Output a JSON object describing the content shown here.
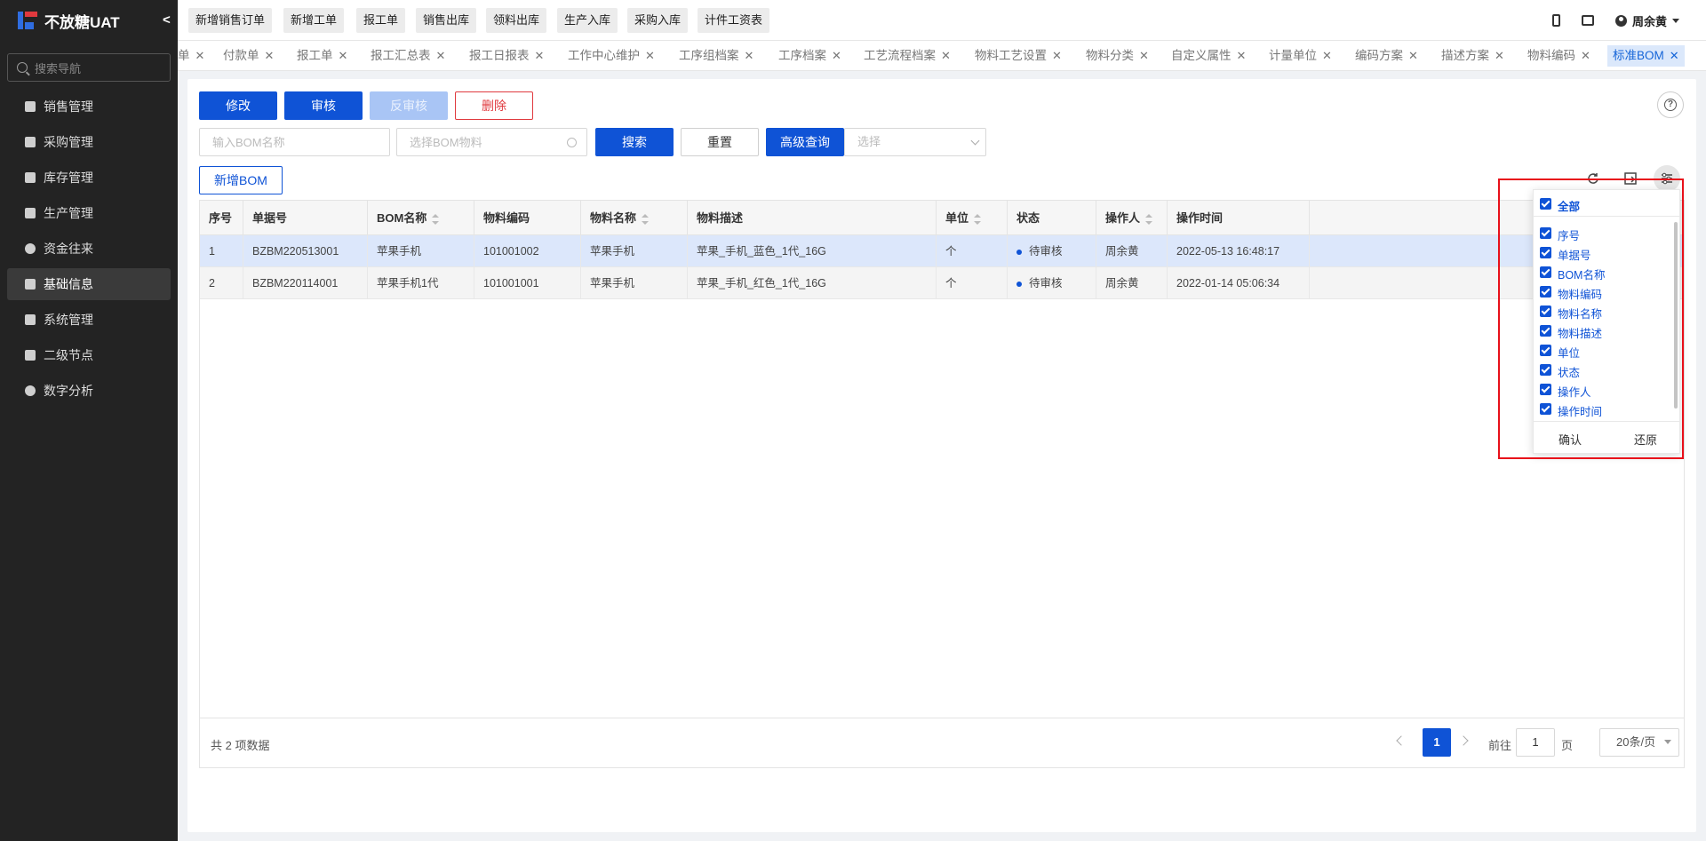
{
  "app": {
    "title": "不放糖UAT"
  },
  "sidebar": {
    "search_placeholder": "搜索导航",
    "items": [
      {
        "label": "销售管理"
      },
      {
        "label": "采购管理"
      },
      {
        "label": "库存管理"
      },
      {
        "label": "生产管理"
      },
      {
        "label": "资金往来"
      },
      {
        "label": "基础信息",
        "active": true
      },
      {
        "label": "系统管理"
      },
      {
        "label": "二级节点"
      },
      {
        "label": "数字分析"
      }
    ]
  },
  "topbar": {
    "quick": [
      "新增销售订单",
      "新增工单",
      "报工单",
      "销售出库",
      "领料出库",
      "生产入库",
      "采购入库",
      "计件工资表"
    ],
    "user": "周余黄"
  },
  "tabs": [
    {
      "label": "单"
    },
    {
      "label": "付款单"
    },
    {
      "label": "报工单"
    },
    {
      "label": "报工汇总表"
    },
    {
      "label": "报工日报表"
    },
    {
      "label": "工作中心维护"
    },
    {
      "label": "工序组档案"
    },
    {
      "label": "工序档案"
    },
    {
      "label": "工艺流程档案"
    },
    {
      "label": "物料工艺设置"
    },
    {
      "label": "物料分类"
    },
    {
      "label": "自定义属性"
    },
    {
      "label": "计量单位"
    },
    {
      "label": "编码方案"
    },
    {
      "label": "描述方案"
    },
    {
      "label": "物料编码"
    },
    {
      "label": "标准BOM",
      "active": true
    }
  ],
  "toolbar": {
    "edit": "修改",
    "approve": "审核",
    "unapprove": "反审核",
    "delete": "删除"
  },
  "filters": {
    "bom_name_placeholder": "输入BOM名称",
    "bom_material_placeholder": "选择BOM物料",
    "search": "搜索",
    "reset": "重置",
    "advanced": "高级查询",
    "select_placeholder": "选择",
    "new_bom": "新增BOM"
  },
  "table": {
    "columns": [
      "序号",
      "单据号",
      "BOM名称",
      "物料编码",
      "物料名称",
      "物料描述",
      "单位",
      "状态",
      "操作人",
      "操作时间"
    ],
    "rows": [
      [
        "1",
        "BZBM220513001",
        "苹果手机",
        "101001002",
        "苹果手机",
        "苹果_手机_蓝色_1代_16G",
        "个",
        "待审核",
        "周余黄",
        "2022-05-13 16:48:17"
      ],
      [
        "2",
        "BZBM220114001",
        "苹果手机1代",
        "101001001",
        "苹果手机",
        "苹果_手机_红色_1代_16G",
        "个",
        "待审核",
        "周余黄",
        "2022-01-14 05:06:34"
      ]
    ]
  },
  "pagination": {
    "total": "共 2 项数据",
    "current": "1",
    "goto_label": "前往",
    "goto_value": "1",
    "page_unit": "页",
    "page_size": "20条/页"
  },
  "column_settings": {
    "all": "全部",
    "columns": [
      "序号",
      "单据号",
      "BOM名称",
      "物料编码",
      "物料名称",
      "物料描述",
      "单位",
      "状态",
      "操作人",
      "操作时间"
    ],
    "confirm": "确认",
    "restore": "还原"
  },
  "colors": {
    "primary": "#0f53d6",
    "danger": "#e0393e",
    "highlight": "#e8101a"
  }
}
